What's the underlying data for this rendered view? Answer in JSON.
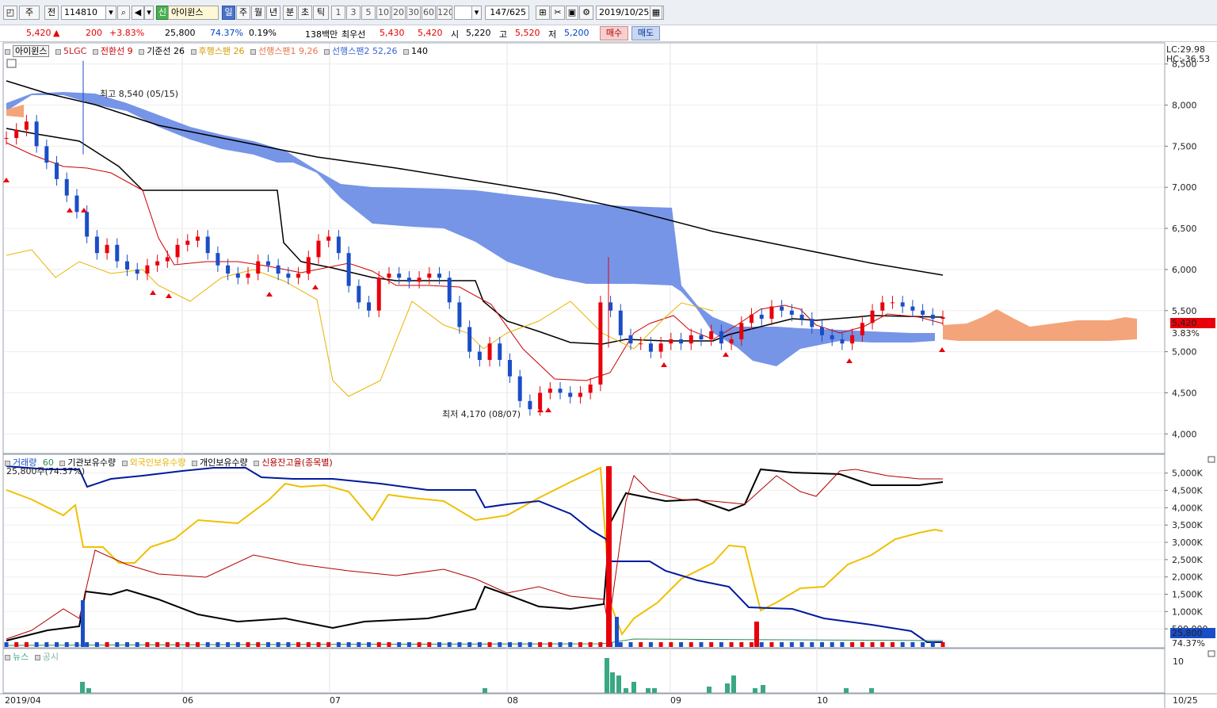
{
  "toolbar": {
    "type_select": "주",
    "prev_label": "전",
    "code": "114810",
    "credit_badge": "신",
    "stock_name": "아이윈스",
    "periods": [
      "일",
      "주",
      "월",
      "년",
      "분",
      "초",
      "틱"
    ],
    "active_period": "일",
    "intervals": [
      "1",
      "3",
      "5",
      "10",
      "20",
      "30",
      "60",
      "120"
    ],
    "count": "147",
    "count_total": "/625",
    "date": "2019/10/25"
  },
  "quote": {
    "price": "5,420",
    "change_arrow": "▲",
    "change": "200",
    "change_pct": "+3.83%",
    "volume": "25,800",
    "volume_ratio": "74.37%",
    "turnover": "0.19%",
    "amount": "138백만",
    "best_ask_label": "최우선",
    "best_ask": "5,430",
    "best_bid": "5,420",
    "open_label": "시",
    "open": "5,220",
    "high_label": "고",
    "high": "5,520",
    "low_label": "저",
    "low": "5,200",
    "buy_button": "매수",
    "sell_button": "매도"
  },
  "price_panel": {
    "legend": {
      "name": "아이윈스",
      "ma": "5LGC",
      "conversion": "전환선 9",
      "base": "기준선 26",
      "lagging": "후행스팬 26",
      "lead1": "선행스팬1 9,26",
      "lead2": "선행스팬2 52,26",
      "long_ma": "140"
    },
    "lc": "LC:29.98",
    "hc": "HC:-36.53",
    "y_ticks": [
      "8,500",
      "8,000",
      "7,500",
      "7,000",
      "6,500",
      "6,000",
      "5,500",
      "5,000",
      "4,500",
      "4,000"
    ],
    "current_price": "5,420",
    "current_pct": "3.83%",
    "high_note": "최고 8,540 (05/15)",
    "low_note": "최저 4,170 (08/07)"
  },
  "volume_panel": {
    "legend": {
      "volume": "거래량",
      "volume_ma": "60",
      "institution": "기관보유수량",
      "foreign": "외국인보유수량",
      "individual": "개인보유수량",
      "credit": "신용잔고율(종목별)"
    },
    "top_note": "25,800주(74.37%)",
    "y_ticks": [
      "5,000K",
      "4,500K",
      "4,000K",
      "3,500K",
      "3,000K",
      "2,500K",
      "2,000K",
      "1,500K",
      "1,000K",
      "500,000"
    ],
    "current_volume": "25,800",
    "current_ratio": "74.37%"
  },
  "news_panel": {
    "legend": {
      "news": "뉴스",
      "disclosure": "공시"
    },
    "y_tick": "10"
  },
  "x_axis": {
    "labels": [
      "2019/04",
      "06",
      "07",
      "08",
      "09",
      "10",
      "10/25"
    ]
  },
  "colors": {
    "up": "#e8000b",
    "down": "#1a4ec7",
    "cloud_bear": "#6f8fe6",
    "cloud_bull": "#f4a47a",
    "lagging": "#f0c000",
    "conversion": "#cc0000",
    "base": "#000000",
    "news_bar": "#3aa882"
  },
  "chart_data": {
    "type": "candlestick",
    "x_range": [
      "2019/04",
      "2019/10/25"
    ],
    "price_ylim": [
      3800,
      8700
    ],
    "high": {
      "value": 8540,
      "date": "05/15"
    },
    "low": {
      "value": 4170,
      "date": "08/07"
    },
    "closes_approx": [
      7600,
      7700,
      7800,
      7500,
      7300,
      7100,
      6900,
      6700,
      6400,
      6200,
      6300,
      6100,
      6000,
      5950,
      6050,
      6100,
      6150,
      6300,
      6350,
      6400,
      6200,
      6050,
      5950,
      5900,
      5950,
      6100,
      6050,
      5950,
      5900,
      5950,
      6150,
      6350,
      6400,
      6200,
      5800,
      5600,
      5500,
      5900,
      5950,
      5900,
      5850,
      5900,
      5950,
      5900,
      5600,
      5300,
      5000,
      4900,
      5100,
      4900,
      4700,
      4400,
      4300,
      4500,
      4550,
      4500,
      4450,
      4500,
      4600,
      5600,
      5500,
      5200,
      5100,
      5100,
      5000,
      5100,
      5150,
      5100,
      5200,
      5150,
      5250,
      5100,
      5150,
      5350,
      5450,
      5400,
      5550,
      5500,
      5450,
      5400,
      5300,
      5200,
      5150,
      5100,
      5200,
      5350,
      5500,
      5600,
      5600,
      5550,
      5500,
      5450,
      5400,
      5420
    ],
    "volume_ylim": [
      0,
      5200000
    ]
  }
}
